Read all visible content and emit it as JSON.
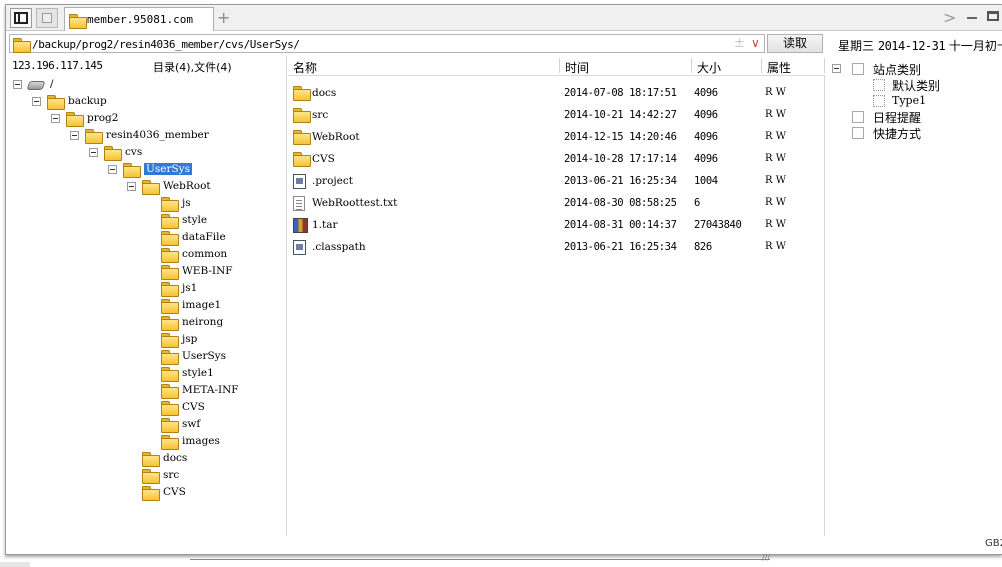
{
  "tabs": {
    "active_title": "member.95081.com",
    "new_tab_symbol": "+"
  },
  "window_controls": {
    "forward_symbol": ">"
  },
  "address": {
    "path": "/backup/prog2/resin4036_member/cvs/UserSys/",
    "star_symbol": "±",
    "dropdown_symbol": "∨",
    "read_button": "读取"
  },
  "date_display": {
    "weekday": "星期三",
    "date": "2014-12-31",
    "lunar": "十一月初十"
  },
  "left_pane": {
    "host": "123.196.117.145",
    "dir_count": "目录(4),文件(4)",
    "tree": [
      {
        "label": "/",
        "icon": "drive-icon",
        "toggle": true,
        "selected": false
      },
      {
        "label": "backup",
        "icon": "folder-icon",
        "toggle": true,
        "selected": false
      },
      {
        "label": "prog2",
        "icon": "folder-icon",
        "toggle": true,
        "selected": false
      },
      {
        "label": "resin4036_member",
        "icon": "folder-icon",
        "toggle": true,
        "selected": false
      },
      {
        "label": "cvs",
        "icon": "folder-icon",
        "toggle": true,
        "selected": false
      },
      {
        "label": "UserSys",
        "icon": "folder-icon",
        "toggle": true,
        "selected": true
      },
      {
        "label": "WebRoot",
        "icon": "folder-icon",
        "toggle": true,
        "selected": false
      },
      {
        "label": "js",
        "icon": "folder-icon",
        "toggle": false,
        "selected": false
      },
      {
        "label": "style",
        "icon": "folder-icon",
        "toggle": false,
        "selected": false
      },
      {
        "label": "dataFile",
        "icon": "folder-icon",
        "toggle": false,
        "selected": false
      },
      {
        "label": "common",
        "icon": "folder-icon",
        "toggle": false,
        "selected": false
      },
      {
        "label": "WEB-INF",
        "icon": "folder-icon",
        "toggle": false,
        "selected": false
      },
      {
        "label": "js1",
        "icon": "folder-icon",
        "toggle": false,
        "selected": false
      },
      {
        "label": "image1",
        "icon": "folder-icon",
        "toggle": false,
        "selected": false
      },
      {
        "label": "neirong",
        "icon": "folder-icon",
        "toggle": false,
        "selected": false
      },
      {
        "label": "jsp",
        "icon": "folder-icon",
        "toggle": false,
        "selected": false
      },
      {
        "label": "UserSys",
        "icon": "folder-icon",
        "toggle": false,
        "selected": false
      },
      {
        "label": "style1",
        "icon": "folder-icon",
        "toggle": false,
        "selected": false
      },
      {
        "label": "META-INF",
        "icon": "folder-icon",
        "toggle": false,
        "selected": false
      },
      {
        "label": "CVS",
        "icon": "folder-icon",
        "toggle": false,
        "selected": false
      },
      {
        "label": "swf",
        "icon": "folder-icon",
        "toggle": false,
        "selected": false
      },
      {
        "label": "images",
        "icon": "folder-icon",
        "toggle": false,
        "selected": false
      },
      {
        "label": "docs",
        "icon": "folder-icon",
        "toggle": false,
        "selected": false
      },
      {
        "label": "src",
        "icon": "folder-icon",
        "toggle": false,
        "selected": false
      },
      {
        "label": "CVS",
        "icon": "folder-icon",
        "toggle": false,
        "selected": false
      }
    ]
  },
  "file_list": {
    "columns": [
      "名称",
      "时间",
      "大小",
      "属性"
    ],
    "rows": [
      {
        "name": "docs",
        "icon": "folder-icon",
        "time": "2014-07-08 18:17:51",
        "size": "4096",
        "attr": "R W"
      },
      {
        "name": "src",
        "icon": "folder-icon",
        "time": "2014-10-21 14:42:27",
        "size": "4096",
        "attr": "R W"
      },
      {
        "name": "WebRoot",
        "icon": "folder-icon",
        "time": "2014-12-15 14:20:46",
        "size": "4096",
        "attr": "R W"
      },
      {
        "name": "CVS",
        "icon": "folder-icon",
        "time": "2014-10-28 17:17:14",
        "size": "4096",
        "attr": "R W"
      },
      {
        "name": ".project",
        "icon": "doc-icon",
        "time": "2013-06-21 16:25:34",
        "size": "1004",
        "attr": "R W"
      },
      {
        "name": "WebRoottest.txt",
        "icon": "txt-icon",
        "time": "2014-08-30 08:58:25",
        "size": "6",
        "attr": "R W"
      },
      {
        "name": "1.tar",
        "icon": "tar-icon",
        "time": "2014-08-31 00:14:37",
        "size": "27043840",
        "attr": "R W"
      },
      {
        "name": ".classpath",
        "icon": "doc-icon",
        "time": "2013-06-21 16:25:34",
        "size": "826",
        "attr": "R W"
      }
    ]
  },
  "right_pane": {
    "items": [
      {
        "label": "站点类别",
        "toggle": true
      },
      {
        "label": "默认类别",
        "toggle": false
      },
      {
        "label": "Type1",
        "toggle": false
      },
      {
        "label": "日程提醒",
        "toggle": false
      },
      {
        "label": "快捷方式",
        "toggle": false
      }
    ]
  },
  "status": {
    "encoding": "GB2"
  }
}
